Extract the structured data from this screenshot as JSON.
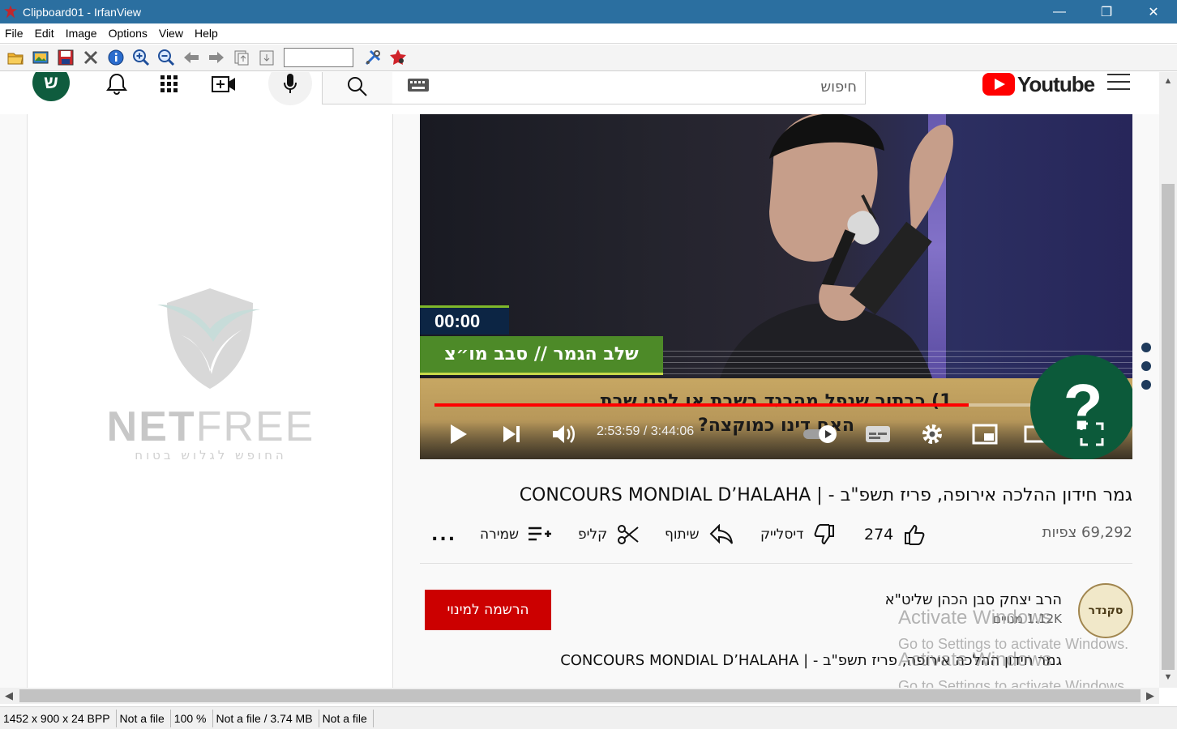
{
  "window": {
    "title": "Clipboard01 - IrfanView",
    "minimize_glyph": "—",
    "restore_glyph": "❐",
    "close_glyph": "✕"
  },
  "menu": [
    "File",
    "Edit",
    "Image",
    "Options",
    "View",
    "Help"
  ],
  "toolbar": {
    "icons": [
      "open-folder-icon",
      "slideshow-icon",
      "save-icon",
      "delete-icon",
      "info-icon",
      "zoom-in-icon",
      "zoom-out-icon",
      "previous-icon",
      "next-icon",
      "copy-icon",
      "paste-icon",
      "settings-icon",
      "irfan-icon"
    ],
    "input_value": ""
  },
  "youtube": {
    "avatar_letter": "ש",
    "search_placeholder": "חיפוש",
    "logo_text": "Youtube"
  },
  "netfree": {
    "brand_part1": "NET",
    "brand_part2": "FREE",
    "tagline": "החופש לגלוש בטוח"
  },
  "player": {
    "overlay_timer": "00:00",
    "overlay_band": "שלב הגמר // סבב מו״צ",
    "caption_line1": "1) כבתור שנפל מהבגד בשבת או לפני שבת",
    "caption_line2": "האם דינו כמוקצה?",
    "current_time": "2:53:59",
    "duration": "3:44:06",
    "time_separator": " / ",
    "progress": 0.78,
    "help_glyph": "?"
  },
  "video": {
    "title": "גמר חידון ההלכה אירופה, פריז תשפ\"ב - | CONCOURS MONDIAL D’HALAHA",
    "views": "69,292 צפיות",
    "likes": "274",
    "dislike_label": "דיסלייק",
    "share_label": "שיתוף",
    "clip_label": "קליפ",
    "save_label": "שמירה",
    "more_label": "..."
  },
  "channel": {
    "logo_text": "סקנדר",
    "name": "הרב יצחק סבן הכהן שליט\"א",
    "subscribers": "1.12K מנויים",
    "subscribe_label": "הרשמה למינוי",
    "description": "גמר חידון ההלכה אירופה, פריז תשפ\"ב - | CONCOURS MONDIAL D’HALAHA"
  },
  "watermark": {
    "heading": "Activate Windows",
    "subtitle": "Go to Settings to activate Windows."
  },
  "statusbar": [
    "1452 x 900 x 24 BPP",
    "Not a file",
    "100 %",
    "Not a file / 3.74 MB",
    "Not a file"
  ]
}
